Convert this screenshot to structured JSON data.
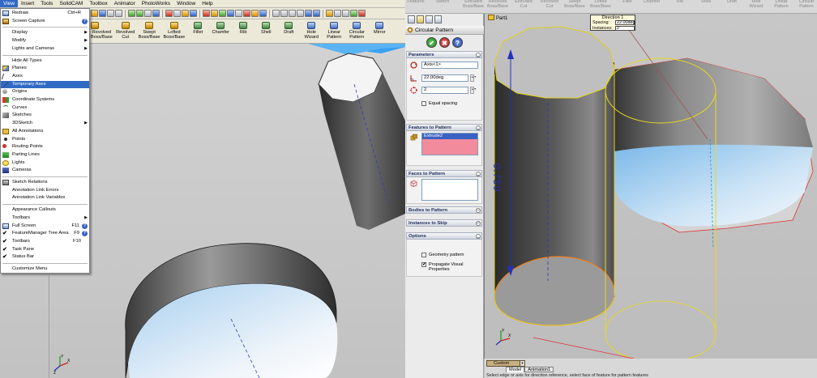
{
  "left": {
    "menubar": [
      "View",
      "Insert",
      "Tools",
      "SolidCAM",
      "Toolbox",
      "Animator",
      "PhotoWorks",
      "Window",
      "Help"
    ],
    "command_labels": [
      "Revolved\nBoss/Base",
      "Revolved\nCut",
      "Swept\nBoss/Base",
      "Lofted\nBoss/Base",
      "Fillet",
      "Chamfer",
      "Rib",
      "Shell",
      "Draft",
      "Hole\nWizard",
      "Linear\nPattern",
      "Circular\nPattern",
      "Mirror"
    ],
    "view_menu": [
      {
        "label": "Redraw",
        "shortcut": "Ctrl+R",
        "icon": "redraw-icon"
      },
      {
        "label": "Screen Capture",
        "arrow": true,
        "help": true,
        "icon": "screen-capture-icon"
      },
      {
        "sep": true
      },
      {
        "label": "Display",
        "arrow": true
      },
      {
        "label": "Modify",
        "arrow": true
      },
      {
        "label": "Lights and Cameras",
        "arrow": true
      },
      {
        "sep": true
      },
      {
        "label": "Hide All Types"
      },
      {
        "label": "Planes",
        "icon": "planes-icon"
      },
      {
        "label": "Axes",
        "icon": "axes-icon"
      },
      {
        "label": "Temporary Axes",
        "icon": "temporary-axes-icon",
        "highlight": true
      },
      {
        "label": "Origins",
        "icon": "origins-icon"
      },
      {
        "label": "Coordinate Systems",
        "icon": "coordinate-systems-icon"
      },
      {
        "label": "Curves",
        "icon": "curves-icon"
      },
      {
        "label": "Sketches",
        "icon": "sketches-icon"
      },
      {
        "label": "3DSketch",
        "arrow": true
      },
      {
        "label": "All Annotations",
        "icon": "annotations-icon"
      },
      {
        "label": "Points",
        "icon": "points-icon"
      },
      {
        "label": "Routing Points",
        "icon": "routing-points-icon"
      },
      {
        "label": "Parting Lines",
        "icon": "parting-lines-icon"
      },
      {
        "label": "Lights",
        "icon": "lights-icon"
      },
      {
        "label": "Cameras",
        "icon": "cameras-icon"
      },
      {
        "sep": true
      },
      {
        "label": "Sketch Relations",
        "icon": "sketch-relations-icon"
      },
      {
        "label": "Annotation Link Errors"
      },
      {
        "label": "Annotation Link Variables"
      },
      {
        "sep": true
      },
      {
        "label": "Appearance Callouts"
      },
      {
        "label": "Toolbars",
        "arrow": true
      },
      {
        "label": "Full Screen",
        "shortcut": "F11",
        "help": true,
        "icon": "full-screen-icon"
      },
      {
        "label": "FeatureManager Tree Area",
        "shortcut": "F9",
        "help": true,
        "check": true
      },
      {
        "label": "Toolbars",
        "shortcut": "F10",
        "check": true
      },
      {
        "label": "Task Pane",
        "check": true
      },
      {
        "label": "Status Bar",
        "check": true
      },
      {
        "sep": true
      },
      {
        "label": "Customize Menu"
      }
    ]
  },
  "right": {
    "command_labels": [
      "Features",
      "Sketch",
      "Extruded\nBoss/Base",
      "Revolved\nBoss/Base",
      "Extruded\nCut",
      "Revolved\nCut",
      "Swept\nBoss/Base",
      "Lofted\nBoss/Base",
      "Fillet",
      "Chamfer",
      "Rib",
      "Shell",
      "Draft",
      "Hole\nWizard",
      "Linear\nPattern",
      "Circular\nPattern"
    ],
    "property_manager": {
      "title": "Circular Pattern",
      "ok_glyph": "✔",
      "cancel_glyph": "✖",
      "help_glyph": "?",
      "parameters": {
        "header": "Parameters",
        "axis": "Axis<1>",
        "angle": "22.00deg",
        "instances": "2",
        "equal_spacing": "Equal spacing",
        "equal_spacing_checked": false
      },
      "features": {
        "header": "Features to Pattern",
        "items": [
          "Extrude2"
        ]
      },
      "faces": {
        "header": "Faces to Pattern"
      },
      "bodies": {
        "header": "Bodies to Pattern"
      },
      "skip": {
        "header": "Instances to Skip"
      },
      "options": {
        "header": "Options",
        "geometry_pattern": "Geometry pattern",
        "geometry_pattern_checked": false,
        "propagate": "Propagate Visual\nProperties",
        "propagate_checked": true,
        "check_glyph": "✔"
      }
    },
    "part_label": "Part1",
    "callout": {
      "title": "Direction 1",
      "spacing_label": "Spacing:",
      "spacing_value": "22.00deg",
      "instances_label": "Instances:",
      "instances_value": "2"
    },
    "dimension": "0.750",
    "configuration": "Custom",
    "tabs": [
      "Model",
      "Animation1"
    ],
    "status": "Select edge or axis for direction reference, select face of feature for pattern features"
  }
}
